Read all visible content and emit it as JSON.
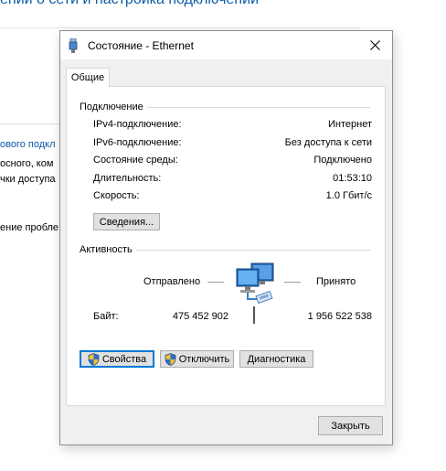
{
  "background": {
    "header": "ении о сети и настройка подключений",
    "lines": [
      {
        "text": "ового подкл",
        "link": true
      },
      {
        "text": "осного, ком",
        "link": false
      },
      {
        "text": "чки доступа",
        "link": false
      },
      {
        "text": "ение пробле",
        "link": false
      }
    ]
  },
  "dialog": {
    "title": "Состояние - Ethernet",
    "close_icon": "close-icon",
    "tab_label": "Общие",
    "connection": {
      "title": "Подключение",
      "rows": [
        {
          "label": "IPv4-подключение:",
          "value": "Интернет"
        },
        {
          "label": "IPv6-подключение:",
          "value": "Без доступа к сети"
        },
        {
          "label": "Состояние среды:",
          "value": "Подключено"
        },
        {
          "label": "Длительность:",
          "value": "01:53:10"
        },
        {
          "label": "Скорость:",
          "value": "1.0 Гбит/с"
        }
      ],
      "details_button": "Сведения..."
    },
    "activity": {
      "title": "Активность",
      "sent_label": "Отправлено",
      "received_label": "Принято",
      "bytes_label": "Байт:",
      "bytes_sent": "475 452 902",
      "bytes_received": "1 956 522 538",
      "network_icon": "network-computers-icon"
    },
    "buttons": {
      "properties": "Свойства",
      "disable": "Отключить",
      "diagnose": "Диагностика",
      "shield_icon": "uac-shield-icon"
    },
    "close_button": "Закрыть"
  },
  "colors": {
    "link": "#0a5aa8",
    "focus": "#0078d7",
    "dialog_bg": "#f0f0f0"
  }
}
